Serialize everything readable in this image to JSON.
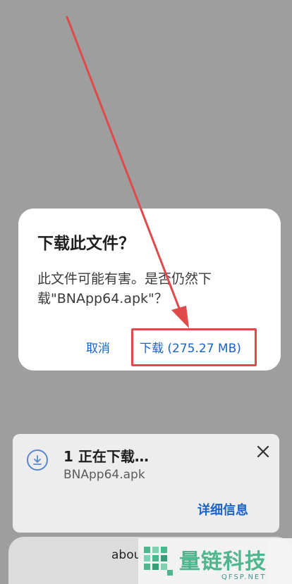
{
  "dialog": {
    "title": "下载此文件？",
    "message": "此文件可能有害。是否仍然下载\"BNApp64.apk\"？",
    "cancel_label": "取消",
    "download_label": "下载 (275.27 MB)"
  },
  "download_card": {
    "status": "1 正在下载…",
    "filename": "BNApp64.apk",
    "details_label": "详细信息"
  },
  "address_bar": {
    "text": "abou"
  },
  "watermark": {
    "text": "量链科技",
    "sub": "QFSP.NET"
  },
  "colors": {
    "accent": "#1a63c8",
    "highlight": "#e04a4a",
    "watermark": "#47b38a"
  }
}
